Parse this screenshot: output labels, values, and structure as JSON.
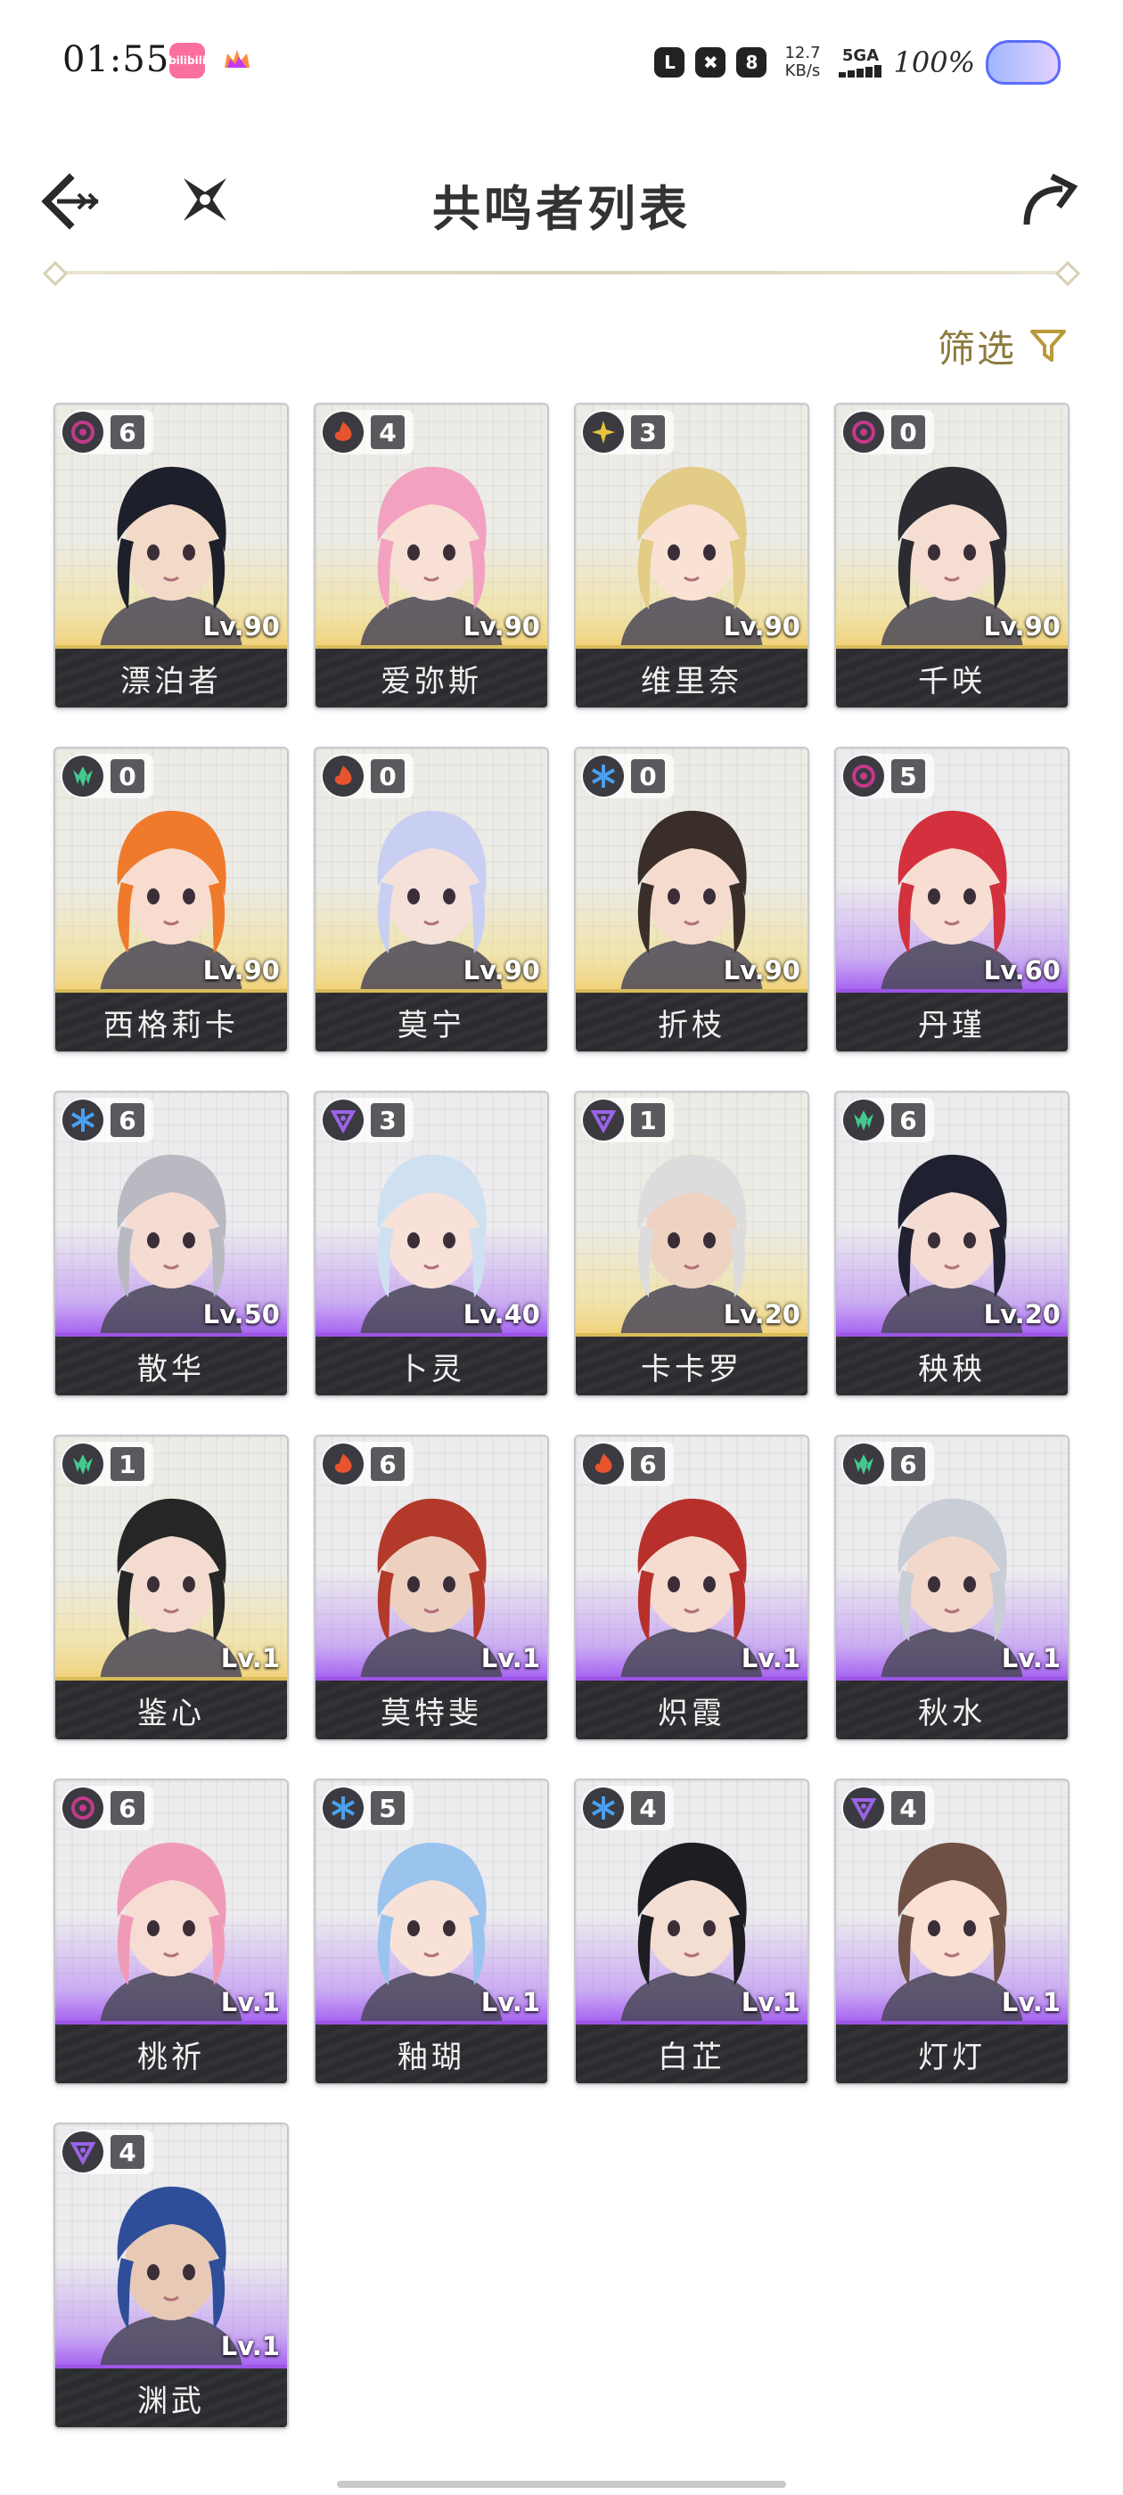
{
  "status_bar": {
    "time": "01:55",
    "app1_label": "bilibili",
    "mini_icons": [
      "L",
      "✖",
      "8"
    ],
    "net_speed_value": "12.7",
    "net_speed_unit": "KB/s",
    "signal_label": "5GA",
    "battery": "100%"
  },
  "header": {
    "title": "共鸣者列表"
  },
  "filter": {
    "label": "筛选"
  },
  "colors": {
    "fusion": "#e8542e",
    "havoc": "#c23a8a",
    "spectro": "#e6c43b",
    "aero": "#45c98e",
    "glacio": "#4aa0ee",
    "electro": "#9a63e8",
    "five_star": "#e3c35d",
    "four_star": "#a661f0"
  },
  "characters": [
    {
      "name": "漂泊者",
      "level": "Lv.90",
      "chain": "6",
      "element": "havoc",
      "rarity": 5,
      "hair": "#1d1f2a",
      "skin": "#f3d9c7"
    },
    {
      "name": "爱弥斯",
      "level": "Lv.90",
      "chain": "4",
      "element": "fusion",
      "rarity": 5,
      "hair": "#f2a2c0",
      "skin": "#f8e0d4"
    },
    {
      "name": "维里奈",
      "level": "Lv.90",
      "chain": "3",
      "element": "spectro",
      "rarity": 5,
      "hair": "#e2cc86",
      "skin": "#f9e2d4"
    },
    {
      "name": "千咲",
      "level": "Lv.90",
      "chain": "0",
      "element": "havoc",
      "rarity": 5,
      "hair": "#2b2b31",
      "skin": "#f6ddd2"
    },
    {
      "name": "西格莉卡",
      "level": "Lv.90",
      "chain": "0",
      "element": "aero",
      "rarity": 5,
      "hair": "#f07a2c",
      "skin": "#f8dccd"
    },
    {
      "name": "莫宁",
      "level": "Lv.90",
      "chain": "0",
      "element": "fusion",
      "rarity": 5,
      "hair": "#c9cff2",
      "skin": "#f6e1da"
    },
    {
      "name": "折枝",
      "level": "Lv.90",
      "chain": "0",
      "element": "glacio",
      "rarity": 5,
      "hair": "#3a2e2a",
      "skin": "#f5dbcd"
    },
    {
      "name": "丹瑾",
      "level": "Lv.60",
      "chain": "5",
      "element": "havoc",
      "rarity": 4,
      "hair": "#d3313d",
      "skin": "#f8ddd2"
    },
    {
      "name": "散华",
      "level": "Lv.50",
      "chain": "6",
      "element": "glacio",
      "rarity": 4,
      "hair": "#b9b9c2",
      "skin": "#f5dcd3"
    },
    {
      "name": "卜灵",
      "level": "Lv.40",
      "chain": "3",
      "element": "electro",
      "rarity": 4,
      "hair": "#cfe0f1",
      "skin": "#f7e1d8"
    },
    {
      "name": "卡卡罗",
      "level": "Lv.20",
      "chain": "1",
      "element": "electro",
      "rarity": 5,
      "hair": "#dcdcdc",
      "skin": "#eed3c3"
    },
    {
      "name": "秧秧",
      "level": "Lv.20",
      "chain": "6",
      "element": "aero",
      "rarity": 4,
      "hair": "#1f2030",
      "skin": "#f5dcd2"
    },
    {
      "name": "鉴心",
      "level": "Lv.1",
      "chain": "1",
      "element": "aero",
      "rarity": 5,
      "hair": "#262626",
      "skin": "#f3dccf"
    },
    {
      "name": "莫特斐",
      "level": "Lv.1",
      "chain": "6",
      "element": "fusion",
      "rarity": 4,
      "hair": "#b33a2a",
      "skin": "#eed0c0"
    },
    {
      "name": "炽霞",
      "level": "Lv.1",
      "chain": "6",
      "element": "fusion",
      "rarity": 4,
      "hair": "#b8302c",
      "skin": "#f6dbcf"
    },
    {
      "name": "秋水",
      "level": "Lv.1",
      "chain": "6",
      "element": "aero",
      "rarity": 4,
      "hair": "#c8cdd6",
      "skin": "#f2d8ca"
    },
    {
      "name": "桃祈",
      "level": "Lv.1",
      "chain": "6",
      "element": "havoc",
      "rarity": 4,
      "hair": "#ef9bb8",
      "skin": "#f6dcd2"
    },
    {
      "name": "釉瑚",
      "level": "Lv.1",
      "chain": "5",
      "element": "glacio",
      "rarity": 4,
      "hair": "#9ac4ee",
      "skin": "#f8e2d8"
    },
    {
      "name": "白芷",
      "level": "Lv.1",
      "chain": "4",
      "element": "glacio",
      "rarity": 4,
      "hair": "#1d1d22",
      "skin": "#f4ddd1"
    },
    {
      "name": "灯灯",
      "level": "Lv.1",
      "chain": "4",
      "element": "electro",
      "rarity": 4,
      "hair": "#6e5044",
      "skin": "#f8e0d3"
    },
    {
      "name": "渊武",
      "level": "Lv.1",
      "chain": "4",
      "element": "electro",
      "rarity": 4,
      "hair": "#2f4e9a",
      "skin": "#e8c9b6"
    }
  ]
}
